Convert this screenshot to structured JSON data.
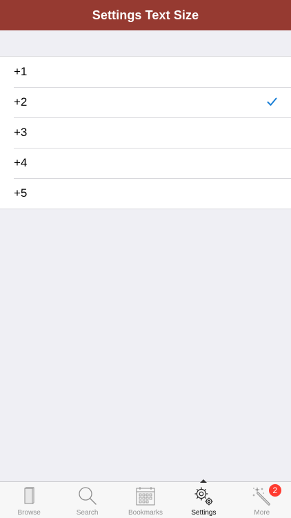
{
  "header": {
    "title": "Settings Text Size",
    "background_color": "#963a31"
  },
  "options": [
    {
      "label": "+1",
      "selected": false
    },
    {
      "label": "+2",
      "selected": true
    },
    {
      "label": "+3",
      "selected": false
    },
    {
      "label": "+4",
      "selected": false
    },
    {
      "label": "+5",
      "selected": false
    }
  ],
  "check_icon": "checkmark-icon",
  "check_color": "#1a7fd6",
  "tabbar": {
    "tabs": [
      {
        "label": "Browse",
        "icon": "book-icon",
        "active": false
      },
      {
        "label": "Search",
        "icon": "search-icon",
        "active": false
      },
      {
        "label": "Bookmarks",
        "icon": "calendar-icon",
        "active": false
      },
      {
        "label": "Settings",
        "icon": "gears-icon",
        "active": true
      },
      {
        "label": "More",
        "icon": "magic-wand-icon",
        "active": false,
        "badge": "2"
      }
    ]
  }
}
